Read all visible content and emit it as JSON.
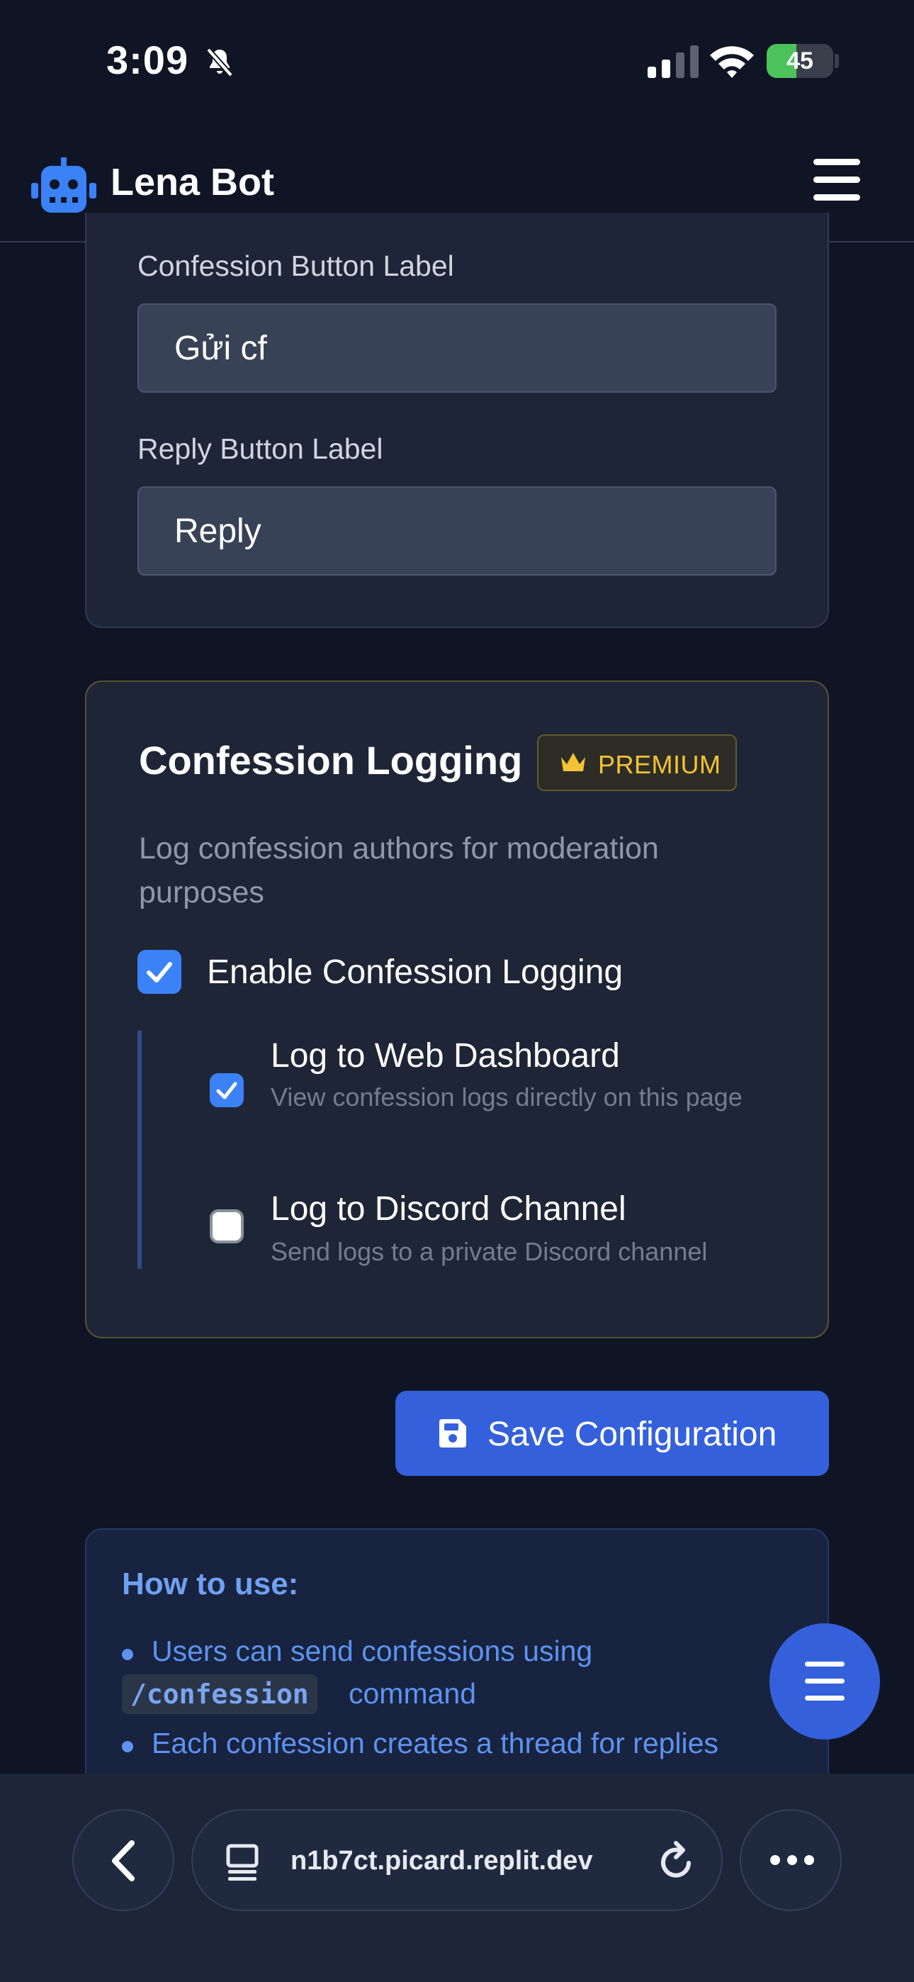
{
  "status_bar": {
    "time": "3:09",
    "battery": "45",
    "battery_fraction": 0.45
  },
  "header": {
    "title": "Lena Bot"
  },
  "labels": {
    "confession_button": "Confession Button Label",
    "confession_button_value": "Gửi cf",
    "reply_button": "Reply Button Label",
    "reply_button_value": "Reply"
  },
  "logging": {
    "title": "Confession Logging",
    "badge": "PREMIUM",
    "description": "Log confession authors for moderation purposes",
    "enable_label": "Enable Confession Logging",
    "enable_checked": true,
    "options": [
      {
        "title": "Log to Web Dashboard",
        "desc": "View confession logs directly on this page",
        "checked": true
      },
      {
        "title": "Log to Discord Channel",
        "desc": "Send logs to a private Discord channel",
        "checked": false
      }
    ]
  },
  "save_button": {
    "label": "Save Configuration"
  },
  "help": {
    "title": "How to use:",
    "item1_a": "Users can send confessions using",
    "item1_code": "/confession",
    "item1_b": "command",
    "item2": "Each confession creates a thread for replies"
  },
  "browser": {
    "url": "n1b7ct.picard.replit.dev"
  },
  "colors": {
    "accent": "#3461db",
    "checkbox": "#3b82f6",
    "premium": "#f2c335",
    "background": "#0f1525"
  }
}
